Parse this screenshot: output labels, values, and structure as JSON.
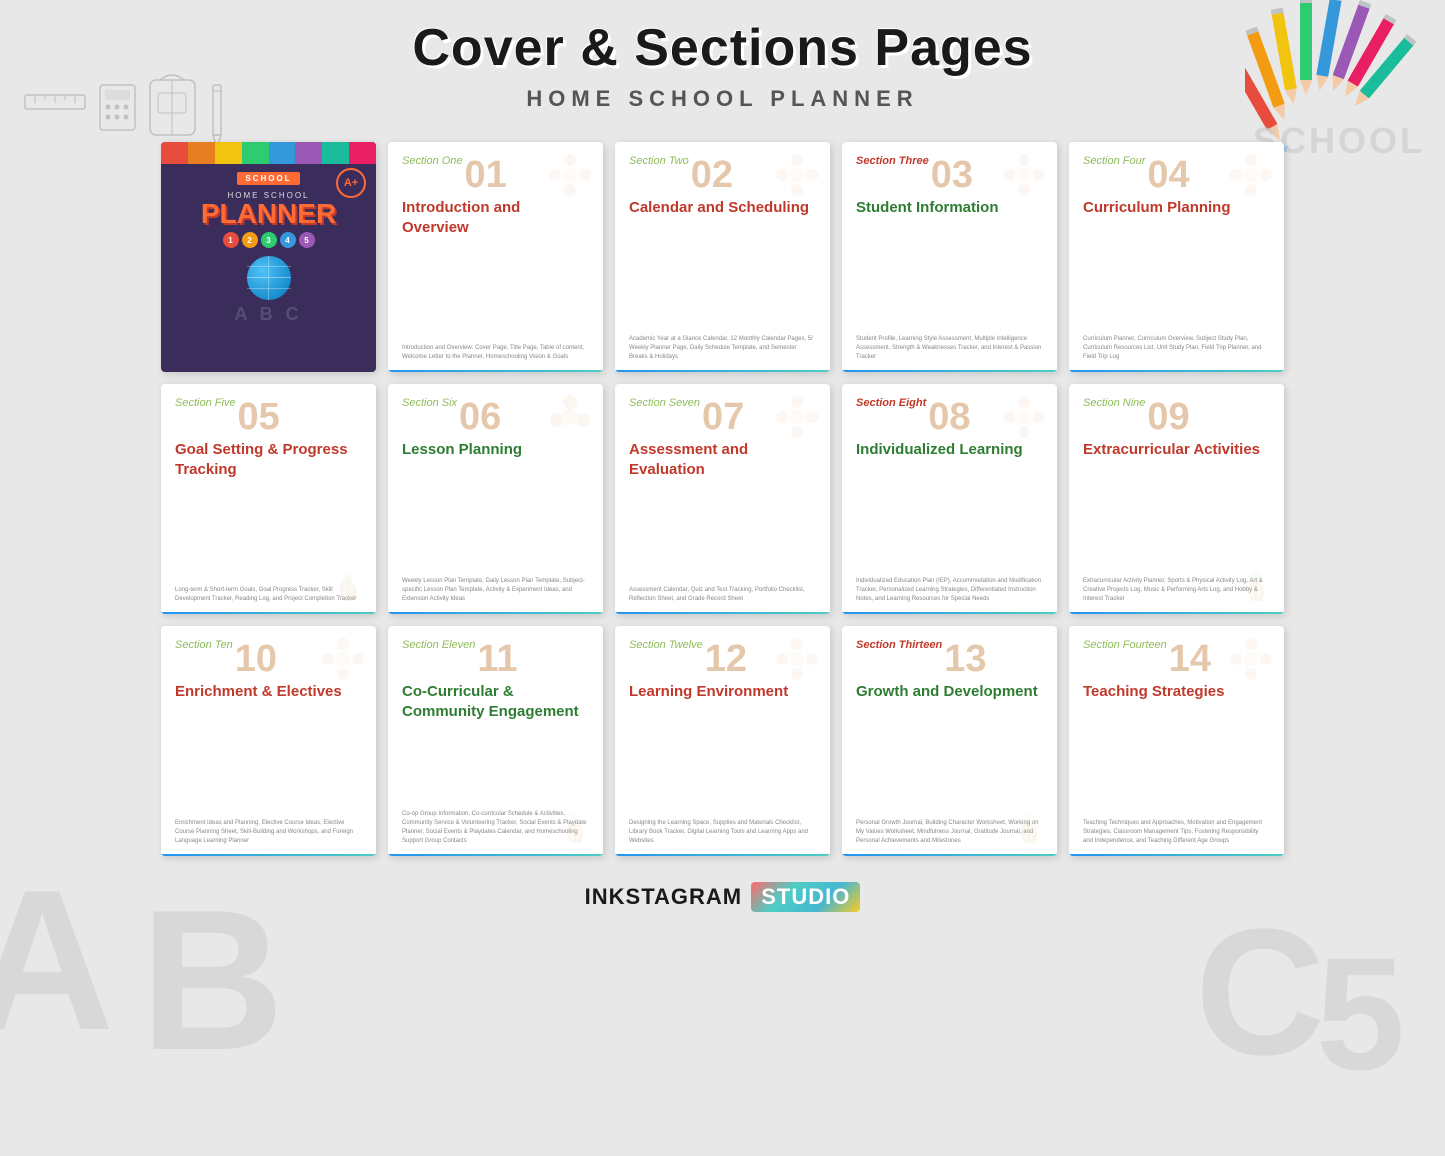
{
  "page": {
    "title": "Cover & Sections Pages",
    "subtitle": "HOME SCHOOL PLANNER",
    "bg_letters": [
      "A",
      "B",
      "C",
      "5"
    ]
  },
  "logo": {
    "ink": "INKSTAGRAM",
    "studio": "STUDIO"
  },
  "cover": {
    "school_label": "SCHOOL",
    "home_school": "HOME SCHOOL",
    "planner": "PLANNER",
    "numbers": [
      "1",
      "2",
      "3",
      "4",
      "5"
    ],
    "grade": "A+"
  },
  "sections": [
    {
      "label": "Section One",
      "number": "01",
      "title": "Introduction and Overview",
      "title_color": "red",
      "desc": "Introduction and Overview: Cover Page, Title Page, Table of content, Welcome Letter to the Planner, Homeschooling Vision & Goals"
    },
    {
      "label": "Section Two",
      "number": "02",
      "title": "Calendar and Scheduling",
      "title_color": "red",
      "desc": "Academic Year at a Glance Calendar, 12 Monthly Calendar Pages, 5/ Weekly Planner Page, Daily Schedule Template, and Semester Breaks & Holidays"
    },
    {
      "label": "Section Three",
      "number": "03",
      "title": "Student Information",
      "title_color": "green",
      "desc": "Student Profile, Learning Style Assessment, Multiple Intelligence Assessment, Strength & Weaknesses Tracker, and Interest & Passion Tracker"
    },
    {
      "label": "Section Four",
      "number": "04",
      "title": "Curriculum Planning",
      "title_color": "red",
      "desc": "Curriculum Planner, Curriculum Overview, Subject Study Plan, Curriculum Resources List, Unit Study Plan, Field Trip Planner, and Field Trip Log"
    },
    {
      "label": "Section Five",
      "number": "05",
      "title": "Goal Setting & Progress Tracking",
      "title_color": "red",
      "desc": "Long-term & Short-term Goals, Goal Progress Tracker, Skill Development Tracker, Reading Log, and Project Completion Tracker"
    },
    {
      "label": "Section Six",
      "number": "06",
      "title": "Lesson Planning",
      "title_color": "green",
      "desc": "Weekly Lesson Plan Template, Daily Lesson Plan Template, Subject-specific Lesson Plan Template, Activity & Experiment Ideas, and Extension Activity Ideas"
    },
    {
      "label": "Section Seven",
      "number": "07",
      "title": "Assessment and Evaluation",
      "title_color": "red",
      "desc": "Assessment Calendar, Quiz and Test Tracking, Portfolio Checklist, Reflection Sheet, and Grade Record Sheet"
    },
    {
      "label": "Section Eight",
      "number": "08",
      "title": "Individualized Learning",
      "title_color": "green",
      "desc": "Individualized Education Plan (IEP), Accommodation and Modification Tracker, Personalized Learning Strategies, Differentiated Instruction Notes, and Learning Resources for Special Needs"
    },
    {
      "label": "Section Nine",
      "number": "09",
      "title": "Extracurricular Activities",
      "title_color": "red",
      "desc": "Extracurricular Activity Planner, Sports & Physical Activity Log, Art & Creative Projects Log, Music & Performing Arts Log, and Hobby & Interest Tracker"
    },
    {
      "label": "Section Ten",
      "number": "10",
      "title": "Enrichment & Electives",
      "title_color": "red",
      "desc": "Enrichment Ideas and Planning, Elective Course Ideas, Elective Course Planning Sheet, Skill-Building and Workshops, and Foreign Language Learning Planner"
    },
    {
      "label": "Section Eleven",
      "number": "11",
      "title": "Co-Curricular & Community Engagement",
      "title_color": "green",
      "desc": "Co-op Group Information, Co-curricular Schedule & Activities, Community Service & Volunteering Tracker, Social Events & Playdate Planner, Social Events & Playdates Calendar, and Homeschooling Support Group Contacts"
    },
    {
      "label": "Section Twelve",
      "number": "12",
      "title": "Learning Environment",
      "title_color": "red",
      "desc": "Designing the Learning Space, Supplies and Materials Checklist, Library Book Tracker, Digital Learning Tools and Learning Apps and Websites"
    },
    {
      "label": "Section Thirteen",
      "number": "13",
      "title": "Growth and Development",
      "title_color": "green",
      "desc": "Personal Growth Journal, Building Character Worksheet, Working on My Values Worksheet, Mindfulness Journal, Gratitude Journal, and Personal Achievements and Milestones"
    },
    {
      "label": "Section Fourteen",
      "number": "14",
      "title": "Teaching Strategies",
      "title_color": "red",
      "desc": "Teaching Techniques and Approaches, Motivation and Engagement Strategies, Classroom Management Tips, Fostering Responsibility and Independence, and Teaching Different Age Groups"
    }
  ],
  "pencil_colors": [
    "#e74c3c",
    "#e67e22",
    "#f1c40f",
    "#2ecc71",
    "#3498db",
    "#9b59b6",
    "#1abc9c",
    "#e91e63",
    "#ff5722",
    "#795548"
  ],
  "num_colors": [
    "#e74c3c",
    "#f39c12",
    "#2ecc71",
    "#3498db",
    "#9b59b6"
  ]
}
